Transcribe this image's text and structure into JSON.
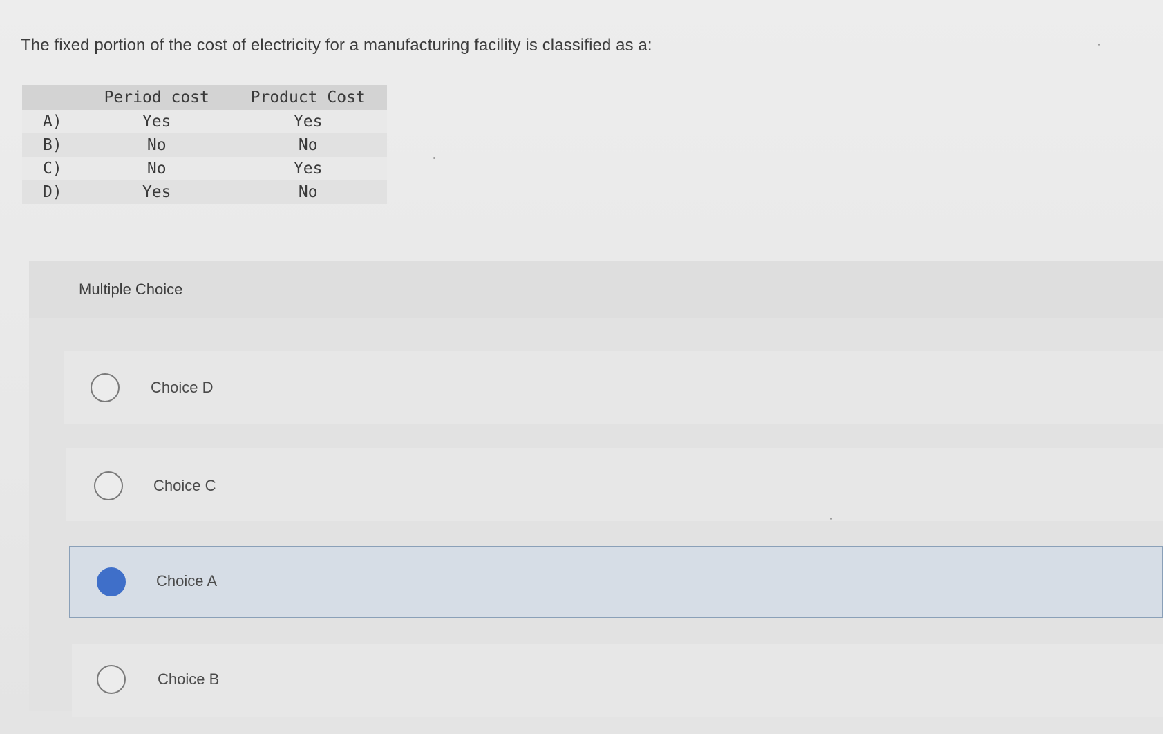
{
  "question": {
    "text": "The fixed portion of the cost of electricity for a manufacturing facility is classified as a:"
  },
  "cost_table": {
    "headers": [
      "",
      "Period cost",
      "Product Cost"
    ],
    "rows": [
      {
        "letter": "A)",
        "period": "Yes",
        "product": "Yes"
      },
      {
        "letter": "B)",
        "period": "No",
        "product": "No"
      },
      {
        "letter": "C)",
        "period": "No",
        "product": "Yes"
      },
      {
        "letter": "D)",
        "period": "Yes",
        "product": "No"
      }
    ]
  },
  "multiple_choice": {
    "title": "Multiple Choice",
    "options": [
      {
        "label": "Choice D",
        "selected": false
      },
      {
        "label": "Choice C",
        "selected": false
      },
      {
        "label": "Choice A",
        "selected": true
      },
      {
        "label": "Choice B",
        "selected": false
      }
    ]
  },
  "colors": {
    "selected_radio": "#3f6fc9",
    "selected_border": "#8aa0b8"
  }
}
